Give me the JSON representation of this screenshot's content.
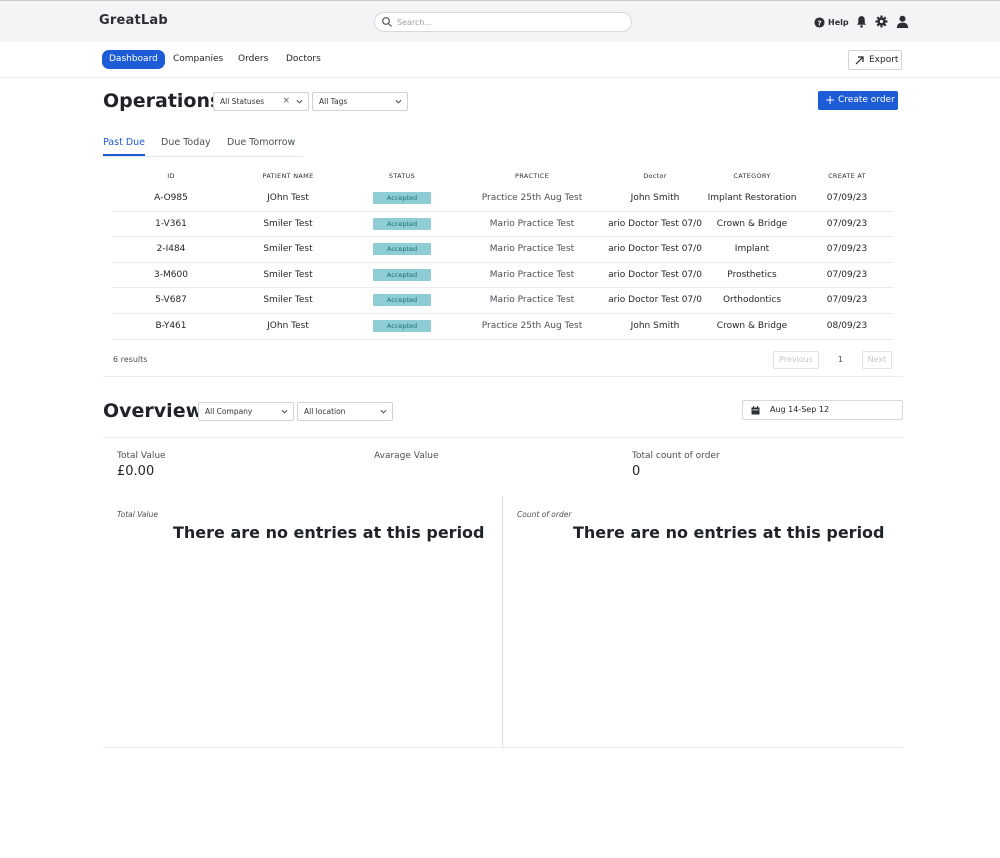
{
  "app": {
    "logo": "GreatLab",
    "search_placeholder": "Search...",
    "help_label": "Help"
  },
  "nav": {
    "items": [
      {
        "label": "Dashboard",
        "active": true
      },
      {
        "label": "Companies",
        "active": false
      },
      {
        "label": "Orders",
        "active": false
      },
      {
        "label": "Doctors",
        "active": false
      }
    ],
    "export_label": "Export"
  },
  "operations": {
    "title": "Operations",
    "status_filter": "All Statuses",
    "tag_filter": "All Tags",
    "create_label": "Create order",
    "tabs": [
      "Past Due",
      "Due Today",
      "Due Tomorrow"
    ],
    "columns": [
      "ID",
      "PATIENT NAME",
      "STATUS",
      "PRACTICE",
      "Doctor",
      "CATEGORY",
      "CREATE AT"
    ],
    "rows": [
      {
        "id": "A-O985",
        "patient": "JOhn Test",
        "status": "Accepted",
        "practice": "Practice 25th Aug Test",
        "doctor": "John Smith",
        "category": "Implant Restoration",
        "created": "07/09/23"
      },
      {
        "id": "1-V361",
        "patient": "Smiler Test",
        "status": "Accepted",
        "practice": "Mario Practice Test",
        "doctor": "ario Doctor Test 07/0",
        "category": "Crown & Bridge",
        "created": "07/09/23"
      },
      {
        "id": "2-I484",
        "patient": "Smiler Test",
        "status": "Accepted",
        "practice": "Mario Practice Test",
        "doctor": "ario Doctor Test 07/0",
        "category": "Implant",
        "created": "07/09/23"
      },
      {
        "id": "3-M600",
        "patient": "Smiler Test",
        "status": "Accepted",
        "practice": "Mario Practice Test",
        "doctor": "ario Doctor Test 07/0",
        "category": "Prosthetics",
        "created": "07/09/23"
      },
      {
        "id": "5-V687",
        "patient": "Smiler Test",
        "status": "Accepted",
        "practice": "Mario Practice Test",
        "doctor": "ario Doctor Test 07/0",
        "category": "Orthodontics",
        "created": "07/09/23"
      },
      {
        "id": "B-Y461",
        "patient": "JOhn Test",
        "status": "Accepted",
        "practice": "Practice 25th Aug Test",
        "doctor": "John Smith",
        "category": "Crown & Bridge",
        "created": "08/09/23"
      }
    ],
    "results_text": "6 results",
    "pager": {
      "previous": "Previous",
      "page": "1",
      "next": "Next"
    }
  },
  "overview": {
    "title": "Overview",
    "company_filter": "All Company",
    "location_filter": "All location",
    "date_range": "Aug 14-Sep 12",
    "kpis": [
      {
        "label": "Total Value",
        "value": "£0.00"
      },
      {
        "label": "Avarage Value",
        "value": ""
      },
      {
        "label": "Total count of order",
        "value": "0"
      }
    ],
    "charts": [
      {
        "title": "Total Value",
        "message": "There are no entries at this period"
      },
      {
        "title": "Count of order",
        "message": "There are no entries at this period"
      }
    ]
  },
  "colors": {
    "primary": "#1e5bd6",
    "badge_bg": "#8ecdd4",
    "badge_text": "#1c6e76",
    "topbar_bg": "#f3f4f6"
  },
  "icons": [
    "search-icon",
    "help-icon",
    "bell-icon",
    "gear-icon",
    "user-icon",
    "export-arrow-icon",
    "chevron-down-icon",
    "clear-icon",
    "plus-icon",
    "calendar-icon"
  ]
}
